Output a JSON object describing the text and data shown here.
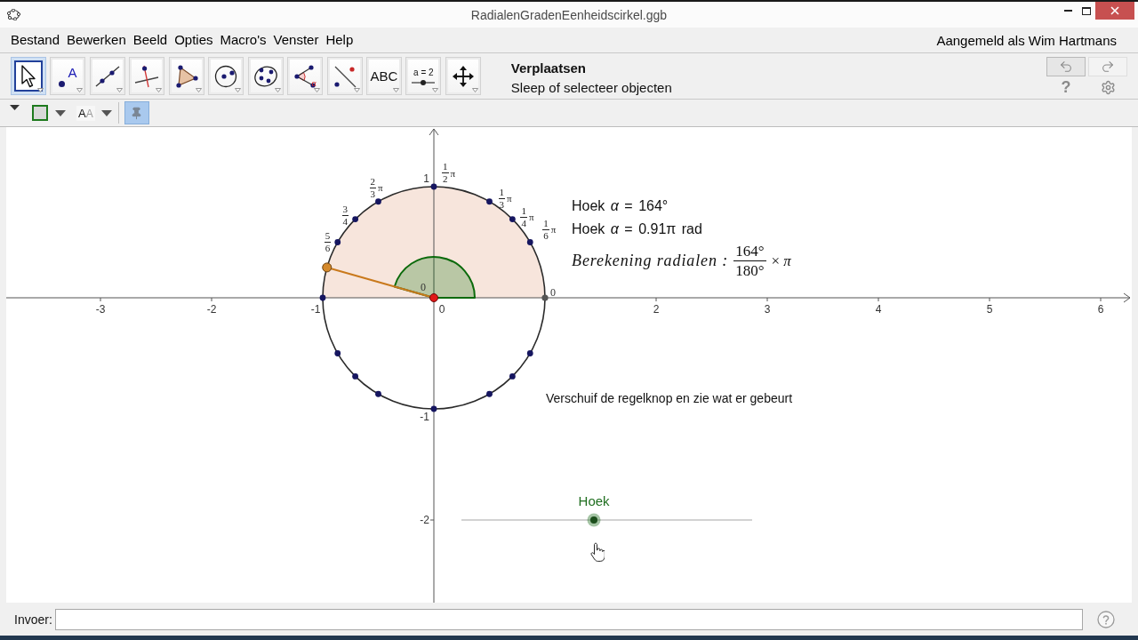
{
  "window": {
    "title": "RadialenGradenEenheidscirkel.ggb"
  },
  "menu": {
    "items": [
      "Bestand",
      "Bewerken",
      "Beeld",
      "Opties",
      "Macro's",
      "Venster",
      "Help"
    ],
    "account": "Aangemeld als Wim Hartmans"
  },
  "toolbar": {
    "tools": [
      {
        "kind": "move",
        "selected": true
      },
      {
        "kind": "point",
        "selected": false,
        "text": "A"
      },
      {
        "kind": "line",
        "selected": false
      },
      {
        "kind": "perpendicular",
        "selected": false
      },
      {
        "kind": "polygon",
        "selected": false
      },
      {
        "kind": "circle",
        "selected": false
      },
      {
        "kind": "conic",
        "selected": false
      },
      {
        "kind": "angle",
        "selected": false,
        "text": "α"
      },
      {
        "kind": "reflect",
        "selected": false
      },
      {
        "kind": "text",
        "selected": false,
        "text": "ABC"
      },
      {
        "kind": "slider",
        "selected": false,
        "text": "a = 2"
      },
      {
        "kind": "pan",
        "selected": false
      }
    ],
    "tool_name": "Verplaatsen",
    "tool_help": "Sleep of selecteer objecten",
    "help": "?"
  },
  "style_bar": {
    "text_size": [
      "A",
      "A"
    ],
    "pin": {
      "selected": true
    }
  },
  "graphics": {
    "x_labels": [
      "-3",
      "-2",
      "-1",
      "0",
      "2",
      "3",
      "4",
      "5",
      "6"
    ],
    "y_labels": [
      "1",
      "-1",
      "-2"
    ],
    "origin_label": "0",
    "point_labels": [
      {
        "kind": "fraction",
        "numerator": "5",
        "denominator": "6"
      },
      {
        "kind": "fraction",
        "numerator": "3",
        "denominator": "4"
      },
      {
        "kind": "fraction",
        "numerator": "2",
        "denominator": "3",
        "suffix": "π"
      },
      {
        "kind": "fraction",
        "numerator": "1",
        "denominator": "2",
        "suffix": "π"
      },
      {
        "kind": "fraction",
        "numerator": "1",
        "denominator": "3",
        "suffix": "π"
      },
      {
        "kind": "fraction",
        "numerator": "1",
        "denominator": "4",
        "suffix": "π"
      },
      {
        "kind": "fraction",
        "numerator": "1",
        "denominator": "6",
        "suffix": "π"
      },
      {
        "kind": "plain",
        "text": "0"
      }
    ],
    "lines": [
      "Hoek *α* = 164°",
      "Hoek *α* = 0.91π rad"
    ],
    "formula": {
      "prefix": "Berekening radialen :",
      "numerator": "164°",
      "denominator": "180°",
      "suffix": "× *π*"
    },
    "instruction": "Verschuif de regelknop en zie wat er gebeurt",
    "slider": {
      "label": "Hoek",
      "level": 0.456
    }
  },
  "input_bar": {
    "label": "Invoer:"
  }
}
